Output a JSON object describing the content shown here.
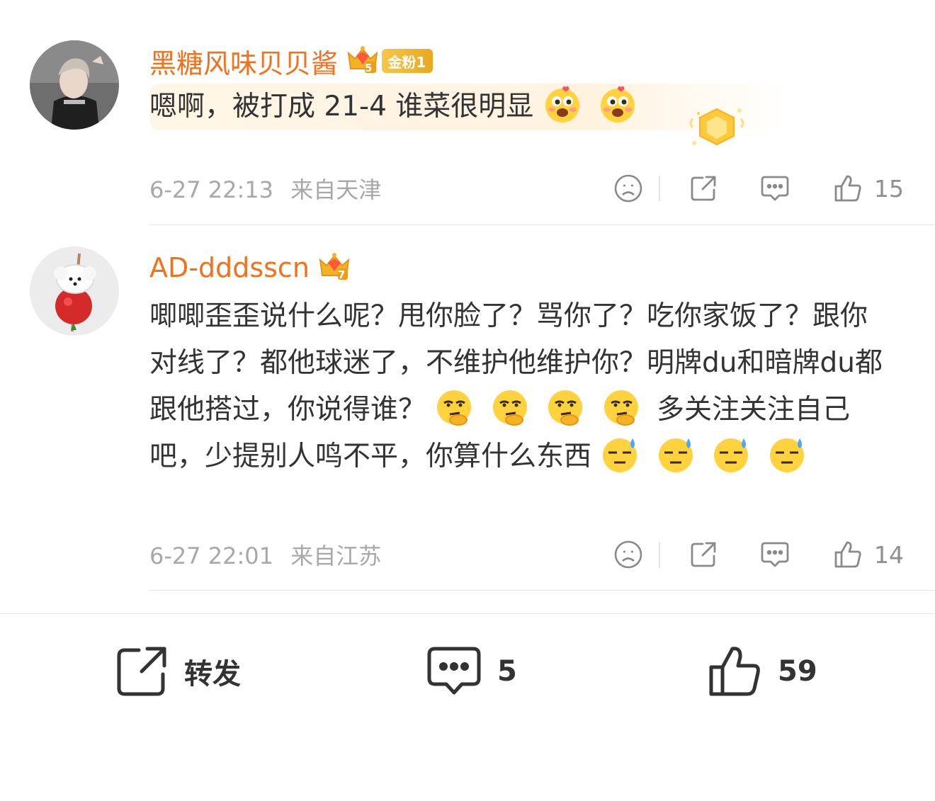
{
  "comments": [
    {
      "username": "黑糖风味贝贝酱",
      "crown_level": "5",
      "fan_badge": "金粉1",
      "text": "嗯啊，被打成 21-4 谁菜很明显",
      "emojis": [
        "heart-eyes-emoji",
        "heart-eyes-emoji"
      ],
      "time": "6-27 22:13",
      "location": "来自天津",
      "likes": "15"
    },
    {
      "username": "AD-dddsscn",
      "crown_level": "7",
      "text_line_a": "唧唧歪歪说什么呢？甩你脸了？骂你了？吃你家饭了？跟你对线了？都他球迷了，不维护他维护你？明牌du和暗牌du都跟他搭过，你说得谁？",
      "text_line_b": "多关注关注自己吧，少提别人鸣不平，你算什么东西",
      "emojis_a": [
        "thinking-emoji",
        "thinking-emoji",
        "thinking-emoji",
        "thinking-emoji"
      ],
      "emojis_b": [
        "sweat-emoji",
        "sweat-emoji",
        "sweat-emoji",
        "sweat-emoji"
      ],
      "time": "6-27 22:01",
      "location": "来自江苏",
      "likes": "14"
    }
  ],
  "bottom_bar": {
    "repost_label": "转发",
    "comment_count": "5",
    "like_count": "59"
  },
  "colors": {
    "username": "#f2711c",
    "meta": "#a8a8a8",
    "text": "#333333",
    "fan_badge": "#f0b429"
  }
}
